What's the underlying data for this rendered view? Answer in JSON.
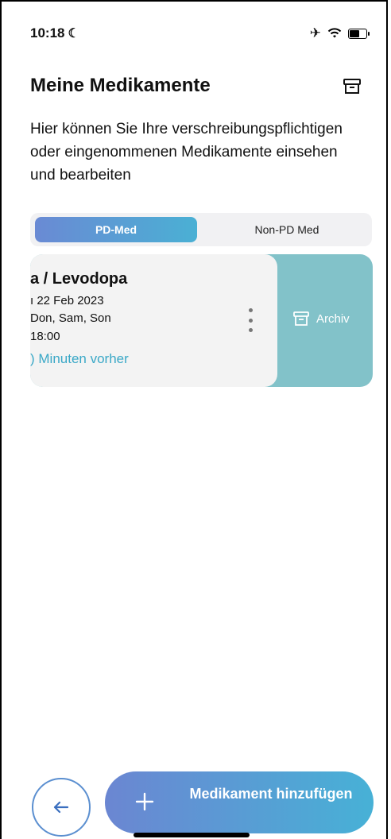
{
  "status": {
    "time": "10:18"
  },
  "header": {
    "title": "Meine Medikamente"
  },
  "description": "Hier können Sie Ihre verschreibungspflichtigen oder eingenommenen Medikamente einsehen und bearbeiten",
  "tabs": [
    {
      "label": "PD-Med",
      "active": true
    },
    {
      "label": "Non-PD Med",
      "active": false
    }
  ],
  "medications": [
    {
      "name": "a / Levodopa",
      "date": "ı 22 Feb 2023",
      "days": "Don, Sam, Son",
      "time": "18:00",
      "reminder": ") Minuten vorher",
      "swipe_action_label": "Archiv"
    }
  ],
  "footer": {
    "add_button_label": "Medikament hinzufügen"
  },
  "colors": {
    "accent": "#4ab0d4",
    "archive_action": "#82c2c9",
    "reminder_text": "#3aa8c7"
  }
}
